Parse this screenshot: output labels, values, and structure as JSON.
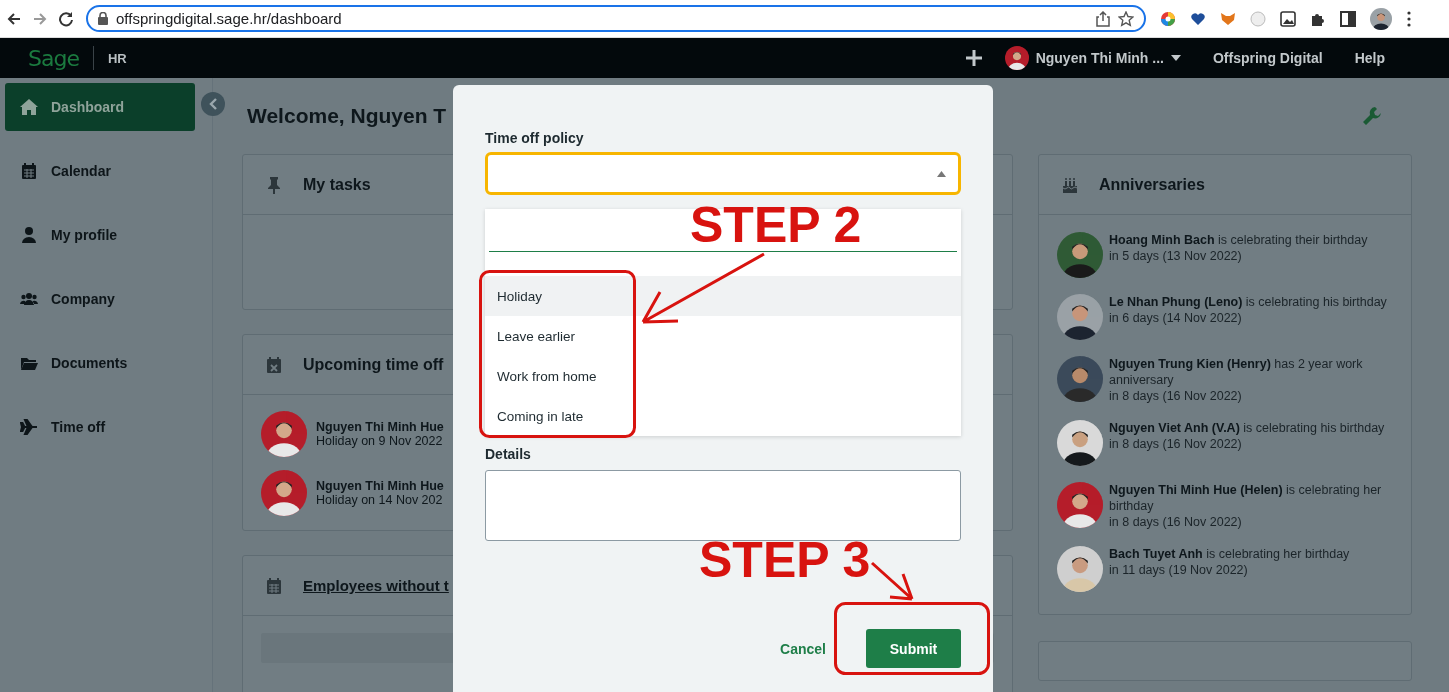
{
  "browser": {
    "url": "offspringdigital.sage.hr/dashboard"
  },
  "header": {
    "logo": "Sage",
    "module": "HR",
    "user_name": "Nguyen Thi Minh ...",
    "company": "Offspring Digital",
    "help": "Help"
  },
  "sidebar": {
    "items": [
      {
        "label": "Dashboard",
        "selected": true
      },
      {
        "label": "Calendar",
        "selected": false
      },
      {
        "label": "My profile",
        "selected": false
      },
      {
        "label": "Company",
        "selected": false
      },
      {
        "label": "Documents",
        "selected": false
      },
      {
        "label": "Time off",
        "selected": false
      }
    ]
  },
  "page": {
    "title": "Welcome, Nguyen T"
  },
  "my_tasks": {
    "title": "My tasks"
  },
  "upcoming_time_off": {
    "title": "Upcoming time off",
    "items": [
      {
        "name": "Nguyen Thi Minh Hue",
        "detail": "Holiday on 9 Nov 2022"
      },
      {
        "name": "Nguyen Thi Minh Hue",
        "detail": "Holiday on 14 Nov 202"
      }
    ]
  },
  "employees_without": {
    "title": "Employees without t"
  },
  "anniversaries": {
    "title": "Anniversaries",
    "items": [
      {
        "text": "**Hoang Minh Bach** is celebrating their birthday",
        "when": "in 5 days (13 Nov 2022)"
      },
      {
        "text": "**Le Nhan Phung (Leno)** is celebrating his birthday",
        "when": "in 6 days (14 Nov 2022)"
      },
      {
        "text": "**Nguyen Trung Kien (Henry)** has 2 year work anniversary",
        "when": "in 8 days (16 Nov 2022)"
      },
      {
        "text": "**Nguyen Viet Anh (V.A)** is celebrating his birthday",
        "when": "in 8 days (16 Nov 2022)"
      },
      {
        "text": "**Nguyen Thi Minh Hue (Helen)** is celebrating her birthday",
        "when": "in 8 days (16 Nov 2022)"
      },
      {
        "text": "**Bach Tuyet Anh** is celebrating her birthday",
        "when": "in 11 days (19 Nov 2022)"
      }
    ]
  },
  "modal": {
    "policy_label": "Time off policy",
    "dropdown_open": true,
    "options": [
      {
        "label": "Holiday",
        "selected": true
      },
      {
        "label": "Leave earlier",
        "selected": false
      },
      {
        "label": "Work from home",
        "selected": false
      },
      {
        "label": "Coming in late",
        "selected": false
      }
    ],
    "details_label": "Details",
    "cancel": "Cancel",
    "submit": "Submit"
  },
  "annotations": [
    {
      "text": "STEP 2"
    },
    {
      "text": "STEP 3"
    }
  ]
}
